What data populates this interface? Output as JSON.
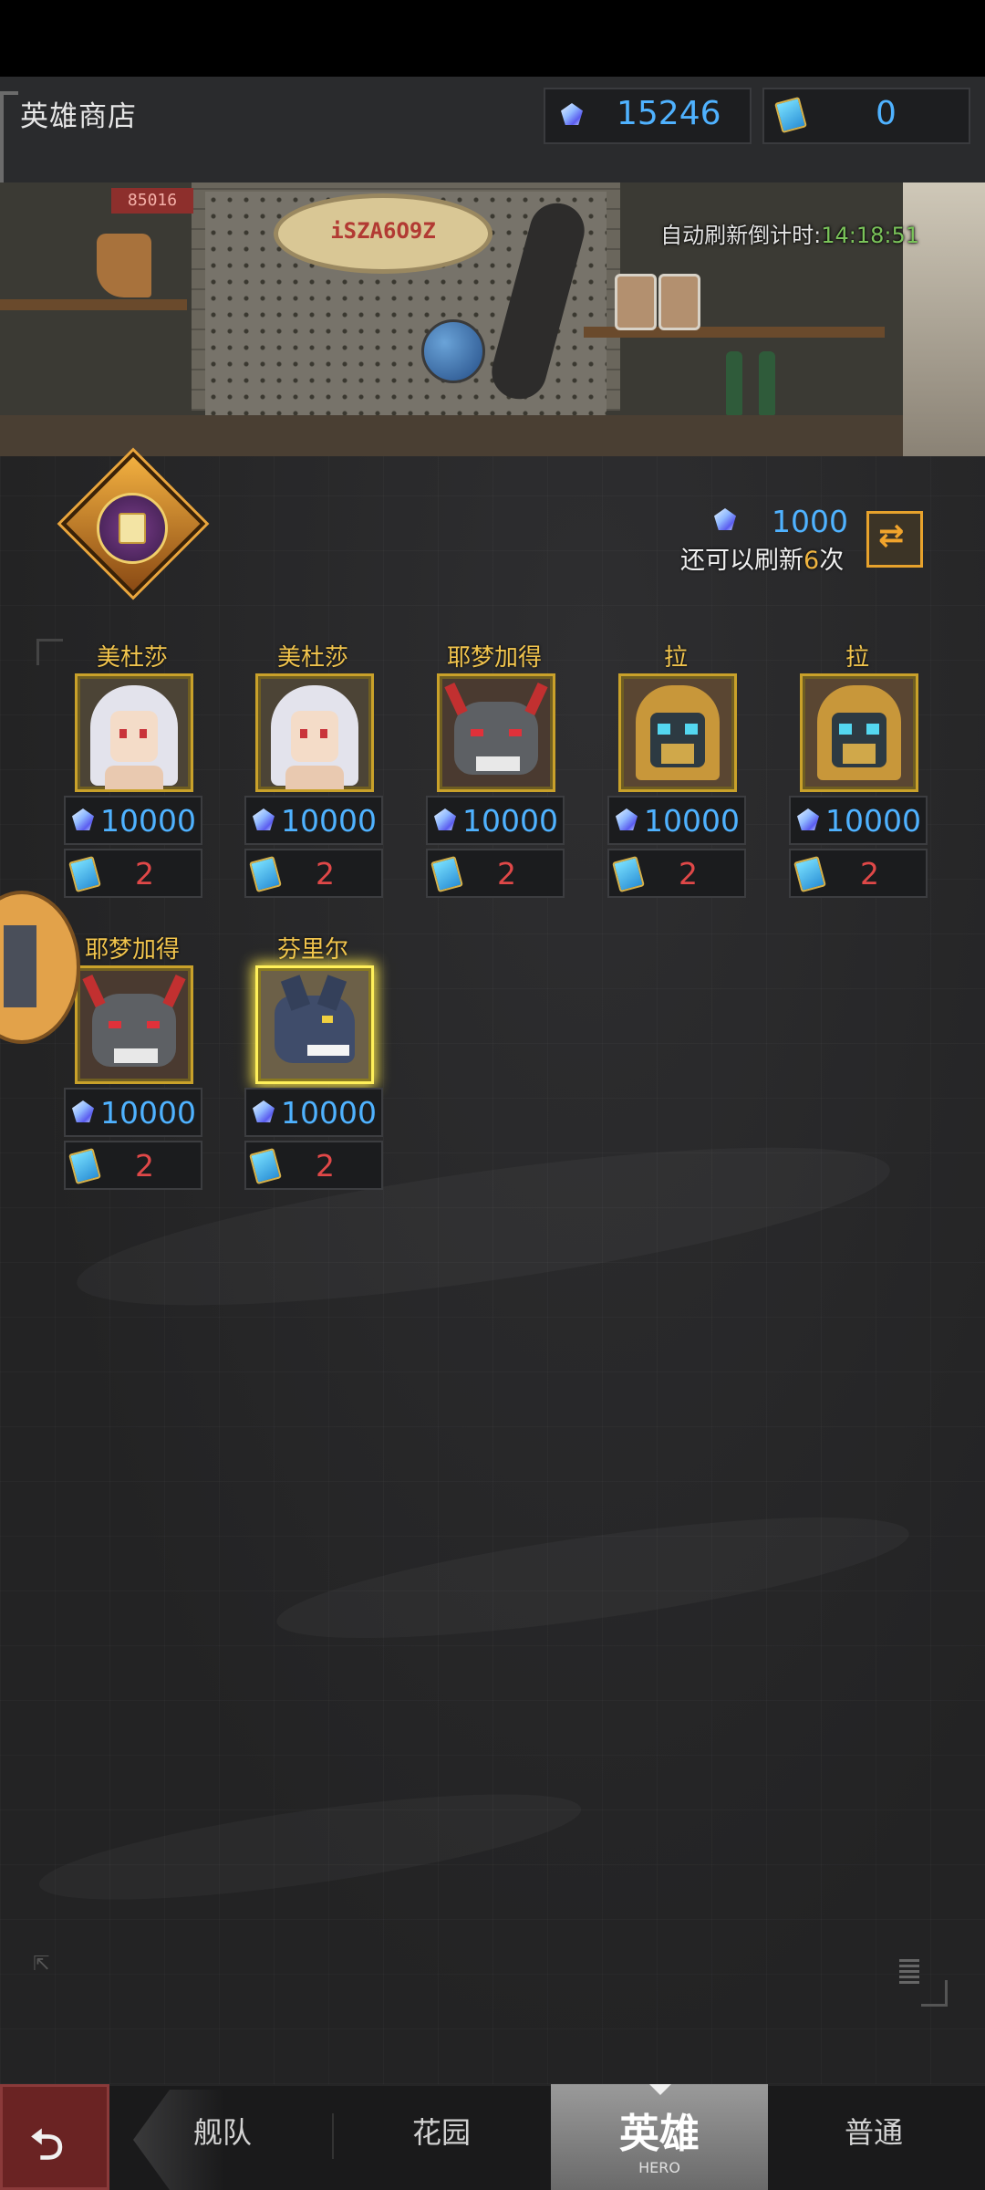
{
  "header": {
    "title": "英雄商店",
    "gems": "15246",
    "tickets": "0"
  },
  "scene": {
    "sign_text": "iSZA6O9Z",
    "code_text": "85016"
  },
  "refresh": {
    "timer_label": "自动刷新倒计时:",
    "timer_value": "14:18:51",
    "cost": "1000",
    "remaining_prefix": "还可以刷新",
    "remaining_count": "6",
    "remaining_suffix": "次"
  },
  "heroes": [
    {
      "name": "美杜莎",
      "portrait": "medusa",
      "gem_price": "10000",
      "ticket_price": "2"
    },
    {
      "name": "美杜莎",
      "portrait": "medusa",
      "gem_price": "10000",
      "ticket_price": "2"
    },
    {
      "name": "耶梦加得",
      "portrait": "jormungandr",
      "gem_price": "10000",
      "ticket_price": "2"
    },
    {
      "name": "拉",
      "portrait": "ra",
      "gem_price": "10000",
      "ticket_price": "2"
    },
    {
      "name": "拉",
      "portrait": "ra",
      "gem_price": "10000",
      "ticket_price": "2"
    },
    {
      "name": "耶梦加得",
      "portrait": "jormungandr",
      "gem_price": "10000",
      "ticket_price": "2"
    },
    {
      "name": "芬里尔",
      "portrait": "fenrir",
      "gem_price": "10000",
      "ticket_price": "2"
    }
  ],
  "nav": {
    "fleet": "舰队",
    "garden": "花园",
    "hero": "英雄",
    "hero_sub": "HERO",
    "normal": "普通"
  },
  "icons": {
    "gem": "gem-icon",
    "ticket": "ticket-icon",
    "refresh": "refresh-icon",
    "back": "back-arrow-icon"
  },
  "colors": {
    "gem_value": "#4fb2ff",
    "ticket_value": "#e04848",
    "hero_name": "#f1c44d",
    "timer": "#7ac35a",
    "accent": "#e7a22c"
  }
}
